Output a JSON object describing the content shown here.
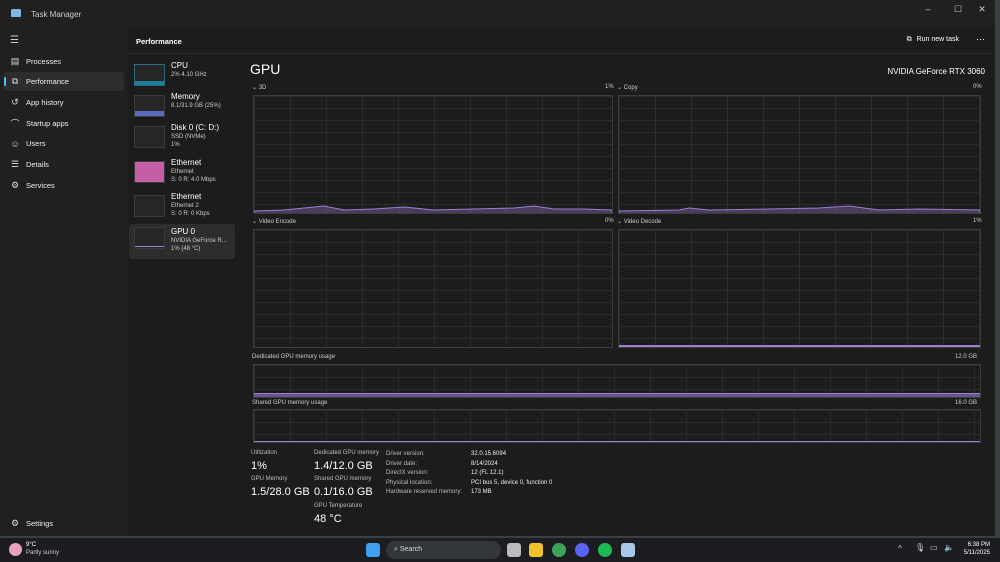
{
  "window": {
    "title": "Task Manager",
    "controls": [
      "–",
      "☐",
      "✕"
    ]
  },
  "nav": {
    "items": [
      {
        "label": "Processes",
        "icon": "processes-icon",
        "glyph": "▤"
      },
      {
        "label": "Performance",
        "icon": "performance-icon",
        "glyph": "⧉"
      },
      {
        "label": "App history",
        "icon": "history-icon",
        "glyph": "↺"
      },
      {
        "label": "Startup apps",
        "icon": "startup-icon",
        "glyph": "⌒"
      },
      {
        "label": "Users",
        "icon": "users-icon",
        "glyph": "☺"
      },
      {
        "label": "Details",
        "icon": "details-icon",
        "glyph": "☰"
      },
      {
        "label": "Services",
        "icon": "services-icon",
        "glyph": "⚙"
      }
    ],
    "settings": "Settings"
  },
  "header": {
    "title": "Performance",
    "run_new_task": "Run new task",
    "more": "⋯"
  },
  "devices": [
    {
      "name": "CPU",
      "sub1": "2% 4.10 GHz",
      "sub2": "",
      "sub3": ""
    },
    {
      "name": "Memory",
      "sub1": "8.1/31.9 GB (25%)",
      "sub2": "",
      "sub3": ""
    },
    {
      "name": "Disk 0 (C: D:)",
      "sub1": "SSD (NVMe)",
      "sub2": "1%",
      "sub3": ""
    },
    {
      "name": "Ethernet",
      "sub1": "Ethernet",
      "sub2": "S: 0 R: 4.0 Mbps",
      "sub3": ""
    },
    {
      "name": "Ethernet",
      "sub1": "Ethernet 2",
      "sub2": "S: 0 R: 0 Kbps",
      "sub3": ""
    },
    {
      "name": "GPU 0",
      "sub1": "NVIDIA GeForce R...",
      "sub2": "1% (48 °C)",
      "sub3": ""
    }
  ],
  "gpu": {
    "title": "GPU",
    "model": "NVIDIA GeForce RTX 3060",
    "graphs": [
      {
        "label": "3D",
        "value": "1%"
      },
      {
        "label": "Copy",
        "value": "0%"
      },
      {
        "label": "Video Encode",
        "value": "0%"
      },
      {
        "label": "Video Decode",
        "value": "1%"
      }
    ],
    "dedicated": {
      "label": "Dedicated GPU memory usage",
      "max": "12.0 GB",
      "fraction": 0.12
    },
    "shared": {
      "label": "Shared GPU memory usage",
      "max": "16.0 GB",
      "fraction": 0.006
    },
    "stats": {
      "utilization_label": "Utilization",
      "utilization": "1%",
      "gpu_memory_label": "GPU Memory",
      "gpu_memory": "1.5/28.0 GB",
      "dedicated_label": "Dedicated GPU memory",
      "dedicated": "1.4/12.0 GB",
      "shared_label": "Shared GPU memory",
      "shared": "0.1/16.0 GB",
      "temp_label": "GPU Temperature",
      "temp": "48 °C"
    },
    "info": [
      {
        "k": "Driver version:",
        "v": "32.0.15.6094"
      },
      {
        "k": "Driver date:",
        "v": "8/14/2024"
      },
      {
        "k": "DirectX version:",
        "v": "12 (FL 12.1)"
      },
      {
        "k": "Physical location:",
        "v": "PCI bus 5, device 0, function 0"
      },
      {
        "k": "Hardware reserved memory:",
        "v": "173 MB"
      }
    ]
  },
  "taskbar": {
    "weather_temp": "9°C",
    "weather_desc": "Partly sunny",
    "search": "Search",
    "time": "6:38 PM",
    "date": "5/11/2025",
    "colors": {
      "accent": "#4cc2ff",
      "gpu": "#9a7fd1"
    }
  }
}
